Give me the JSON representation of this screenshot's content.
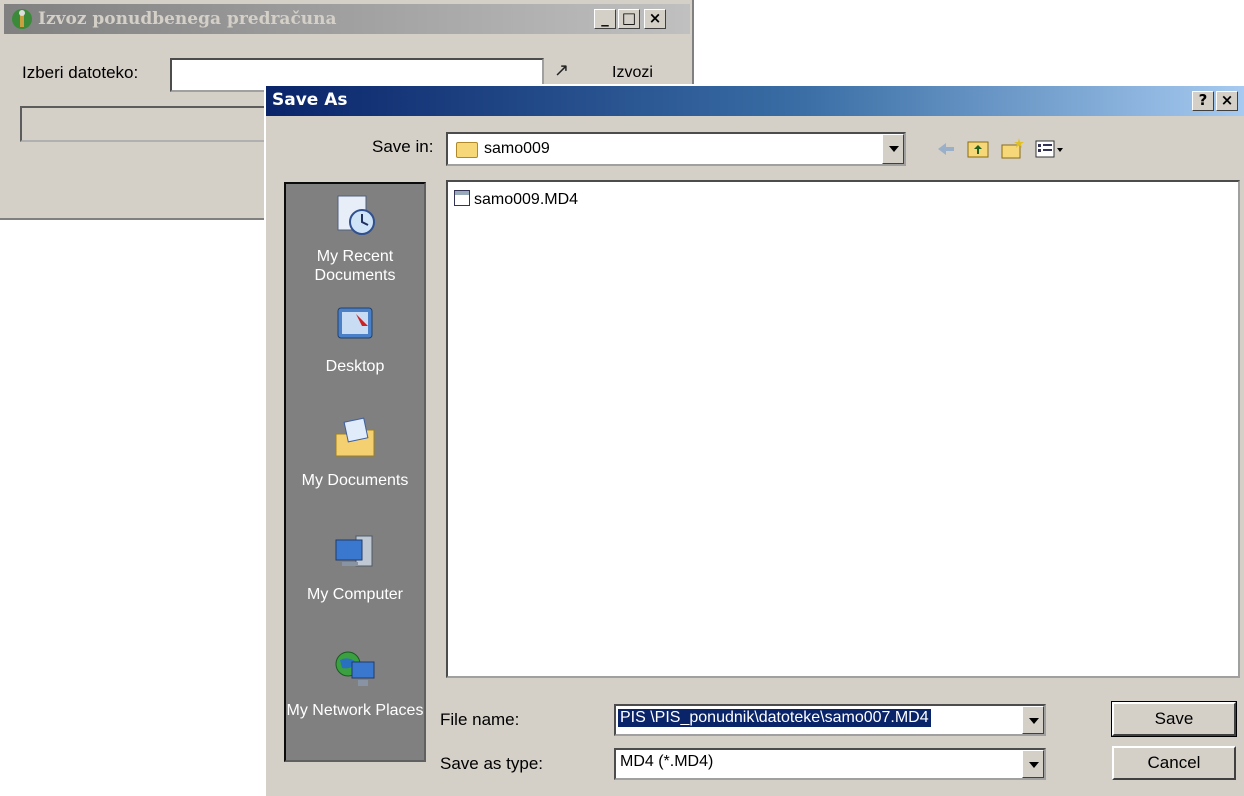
{
  "bg_window": {
    "title": "Izvoz ponudbenega predračuna",
    "file_label": "Izberi datoteko:",
    "file_value": "",
    "export_label": "Izvozi",
    "caption_min": "_",
    "caption_max": "□",
    "caption_close": "×"
  },
  "dialog": {
    "title": "Save As",
    "help_label": "?",
    "close_label": "×",
    "save_in_label": "Save in:",
    "save_in_value": "samo009",
    "places": [
      {
        "label": "My Recent Documents"
      },
      {
        "label": "Desktop"
      },
      {
        "label": "My Documents"
      },
      {
        "label": "My Computer"
      },
      {
        "label": "My Network Places"
      }
    ],
    "files": [
      {
        "name": "samo009.MD4"
      }
    ],
    "file_name_label": "File name:",
    "file_name_value": "PIS    \\PIS_ponudnik\\datoteke\\samo007.MD4",
    "save_type_label": "Save as type:",
    "save_type_value": "MD4 (*.MD4)",
    "save_button": "Save",
    "cancel_button": "Cancel"
  },
  "icons": [
    "app-icon",
    "browse-icon",
    "back-icon",
    "up-folder-icon",
    "new-folder-icon",
    "view-menu-icon",
    "recent-docs-icon",
    "desktop-icon",
    "my-documents-icon",
    "my-computer-icon",
    "network-places-icon",
    "file-icon",
    "folder-icon"
  ],
  "colors": {
    "title_active": "#0a246a",
    "title_inactive": "#808080",
    "face": "#d4d0c8",
    "places_bg": "#808080",
    "selection": "#0a246a"
  }
}
